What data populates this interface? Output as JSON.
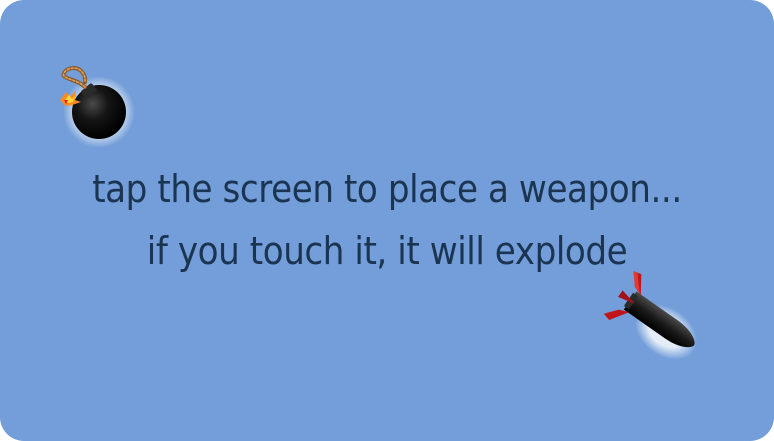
{
  "game": {
    "instructions": {
      "line1": "tap the screen to place a weapon...",
      "line2": "if you touch it, it will explode"
    },
    "weapons": [
      {
        "name": "bomb-icon"
      },
      {
        "name": "missile-icon"
      }
    ],
    "colors": {
      "background": "#739ed9",
      "text": "#1b3451",
      "weapon_body": "#1a1a1a",
      "missile_fins": "#c0161b"
    }
  }
}
